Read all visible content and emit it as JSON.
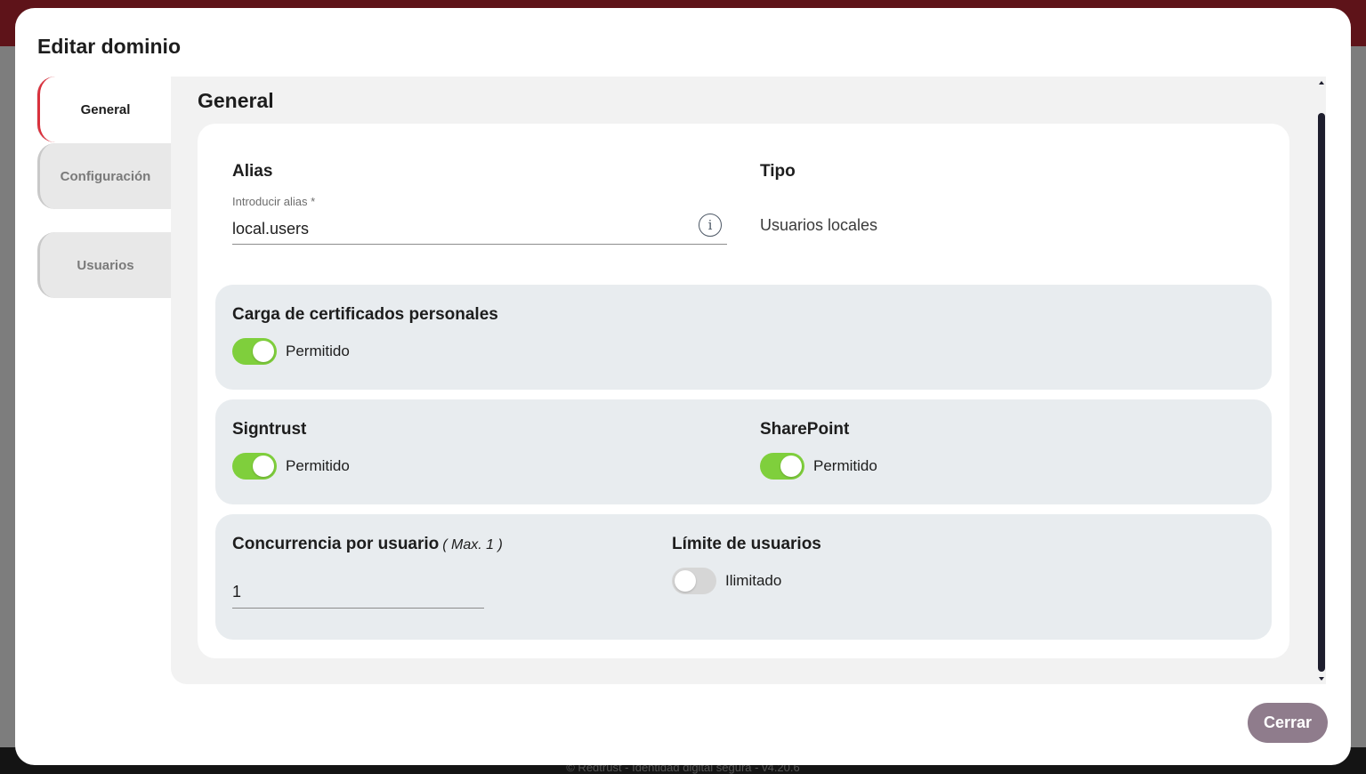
{
  "background": {
    "footer_text": "© Redtrust - Identidad digital segura - v4.20.6"
  },
  "modal": {
    "title": "Editar dominio",
    "tabs": [
      {
        "label": "General",
        "active": true
      },
      {
        "label": "Configuración",
        "active": false
      },
      {
        "label": "Usuarios",
        "active": false
      }
    ],
    "panel_title": "General",
    "alias": {
      "label": "Alias",
      "input_label": "Introducir alias *",
      "value": "local.users"
    },
    "tipo": {
      "label": "Tipo",
      "value": "Usuarios locales"
    },
    "certificados": {
      "title": "Carga de certificados personales",
      "toggle_on": true,
      "toggle_label": "Permitido"
    },
    "signtrust": {
      "title": "Signtrust",
      "toggle_on": true,
      "toggle_label": "Permitido"
    },
    "sharepoint": {
      "title": "SharePoint",
      "toggle_on": true,
      "toggle_label": "Permitido"
    },
    "concurrencia": {
      "title": "Concurrencia por usuario",
      "hint": "( Max. 1 )",
      "value": "1"
    },
    "limite": {
      "title": "Límite de usuarios",
      "toggle_on": false,
      "toggle_label": "Ilimitado"
    },
    "close_label": "Cerrar"
  },
  "colors": {
    "accent_tab": "#d9313d",
    "toggle_on": "#7fcf3c",
    "toggle_off": "#d6d6d6",
    "close_button": "#8f7c8c",
    "section_bg": "#e8ecef"
  },
  "icons": [
    "info-icon",
    "scroll-up-arrow",
    "scroll-down-arrow"
  ]
}
